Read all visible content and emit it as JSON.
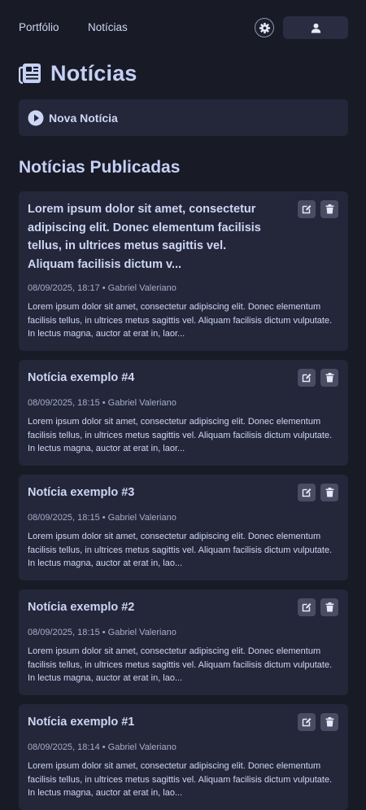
{
  "nav": {
    "links": [
      "Portfólio",
      "Notícias"
    ]
  },
  "icons": {
    "settings": "gear-icon",
    "user": "user-icon",
    "page": "newspaper-icon",
    "new": "play-circle-icon",
    "edit": "edit-icon",
    "delete": "trash-icon"
  },
  "page": {
    "title": "Notícias",
    "new_news_label": "Nova Notícia",
    "section_title": "Notícias Publicadas"
  },
  "news": [
    {
      "title": "Lorem ipsum dolor sit amet, consectetur adipiscing elit. Donec elementum facilisis tellus, in ultrices metus sagittis vel. Aliquam facilisis dictum v...",
      "meta": "08/09/2025, 18:17 • Gabriel Valeriano",
      "excerpt": "Lorem ipsum dolor sit amet, consectetur adipiscing elit. Donec elementum facilisis tellus, in ultrices metus sagittis vel. Aliquam facilisis dictum vulputate. In lectus magna, auctor at erat in, laor..."
    },
    {
      "title": "Notícia exemplo #4",
      "meta": "08/09/2025, 18:15 • Gabriel Valeriano",
      "excerpt": "Lorem ipsum dolor sit amet, consectetur adipiscing elit. Donec elementum facilisis tellus, in ultrices metus sagittis vel. Aliquam facilisis dictum vulputate. In lectus magna, auctor at erat in, laor..."
    },
    {
      "title": "Notícia exemplo #3",
      "meta": "08/09/2025, 18:15 • Gabriel Valeriano",
      "excerpt": "Lorem ipsum dolor sit amet, consectetur adipiscing elit. Donec elementum facilisis tellus, in ultrices metus sagittis vel. Aliquam facilisis dictum vulputate. In lectus magna, auctor at erat in, lao..."
    },
    {
      "title": "Notícia exemplo #2",
      "meta": "08/09/2025, 18:15 • Gabriel Valeriano",
      "excerpt": "Lorem ipsum dolor sit amet, consectetur adipiscing elit. Donec elementum facilisis tellus, in ultrices metus sagittis vel. Aliquam facilisis dictum vulputate. In lectus magna, auctor at erat in, lao..."
    },
    {
      "title": "Notícia exemplo #1",
      "meta": "08/09/2025, 18:14 • Gabriel Valeriano",
      "excerpt": "Lorem ipsum dolor sit amet, consectetur adipiscing elit. Donec elementum facilisis tellus, in ultrices metus sagittis vel. Aliquam facilisis dictum vulputate. In lectus magna, auctor at erat in, lao..."
    }
  ],
  "colors": {
    "background": "#181a25",
    "card": "#24273a",
    "text": "#cdd6f4",
    "muted": "#a5adcb",
    "button": "#494d64"
  }
}
